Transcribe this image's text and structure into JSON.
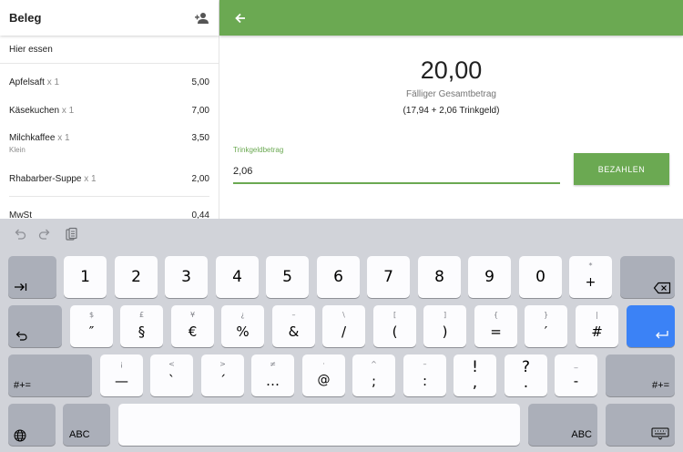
{
  "receipt": {
    "title": "Beleg",
    "order_type": "Hier essen",
    "items": [
      {
        "name": "Apfelsaft",
        "qty": "x 1",
        "price": "5,00",
        "note": ""
      },
      {
        "name": "Käsekuchen",
        "qty": "x 1",
        "price": "7,00",
        "note": ""
      },
      {
        "name": "Milchkaffee",
        "qty": "x 1",
        "price": "3,50",
        "note": "Klein"
      },
      {
        "name": "Rhabarber-Suppe",
        "qty": "x 1",
        "price": "2,00",
        "note": ""
      }
    ],
    "tax_label": "MwSt",
    "tax_value": "0,44"
  },
  "payment": {
    "total": "20,00",
    "total_label": "Fälliger Gesamtbetrag",
    "total_detail": "(17,94 + 2,06 Trinkgeld)",
    "tip_label": "Trinkgeldbetrag",
    "tip_value": "2,06",
    "pay_button": "BEZAHLEN"
  },
  "keyboard": {
    "row1": [
      {
        "alt": "",
        "main": "1"
      },
      {
        "alt": "",
        "main": "2"
      },
      {
        "alt": "",
        "main": "3"
      },
      {
        "alt": "",
        "main": "4"
      },
      {
        "alt": "",
        "main": "5"
      },
      {
        "alt": "",
        "main": "6"
      },
      {
        "alt": "",
        "main": "7"
      },
      {
        "alt": "",
        "main": "8"
      },
      {
        "alt": "",
        "main": "9"
      },
      {
        "alt": "",
        "main": "0"
      },
      {
        "alt": "*",
        "main": "+"
      }
    ],
    "row2": [
      {
        "alt": "$",
        "main": "″"
      },
      {
        "alt": "£",
        "main": "§"
      },
      {
        "alt": "¥",
        "main": "€"
      },
      {
        "alt": "¿",
        "main": "%"
      },
      {
        "alt": "–",
        "main": "&"
      },
      {
        "alt": "\\",
        "main": "/"
      },
      {
        "alt": "[",
        "main": "("
      },
      {
        "alt": "]",
        "main": ")"
      },
      {
        "alt": "{",
        "main": "="
      },
      {
        "alt": "}",
        "main": "′"
      },
      {
        "alt": "|",
        "main": "#"
      }
    ],
    "row3": [
      {
        "alt": "¡",
        "main": "—"
      },
      {
        "alt": "<",
        "main": "`"
      },
      {
        "alt": ">",
        "main": "´"
      },
      {
        "alt": "≠",
        "main": "…"
      },
      {
        "alt": "·",
        "main": "@"
      },
      {
        "alt": "^",
        "main": ";"
      },
      {
        "alt": "–",
        "main": ":"
      },
      {
        "alt": "",
        "main": "!,"
      },
      {
        "alt": "",
        "main": "?."
      },
      {
        "alt": "_",
        "main": "-"
      }
    ],
    "shift_label": "#+=",
    "abc_label": "ABC",
    "icons": {
      "tab": "tab-icon",
      "backspace": "backspace-icon",
      "undo": "undo-icon",
      "redo": "redo-icon",
      "paste": "paste-icon",
      "return": "return-icon",
      "globe": "globe-icon",
      "hide": "keyboard-hide-icon"
    }
  },
  "colors": {
    "accent": "#6ba952",
    "return_key": "#3b82f6",
    "keyboard_bg": "#d1d3d9"
  }
}
